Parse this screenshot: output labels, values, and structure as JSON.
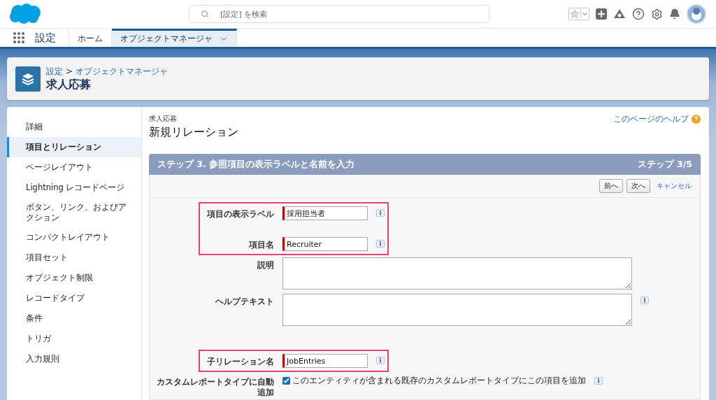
{
  "header": {
    "search": {
      "placeholder": "[設定] を検索"
    }
  },
  "nav": {
    "app_name": "設定",
    "tabs": [
      {
        "label": "ホーム",
        "selected": false,
        "dropdown": false
      },
      {
        "label": "オブジェクトマネージャ",
        "selected": true,
        "dropdown": true
      }
    ]
  },
  "page_header": {
    "breadcrumb": [
      {
        "label": "設定"
      },
      {
        "label": "オブジェクトマネージャ"
      }
    ],
    "separator": ">",
    "title": "求人応募"
  },
  "sidebar": {
    "items": [
      {
        "label": "詳細",
        "selected": false
      },
      {
        "label": "項目とリレーション",
        "selected": true
      },
      {
        "label": "ページレイアウト",
        "selected": false
      },
      {
        "label": "Lightning レコードページ",
        "selected": false
      },
      {
        "label": "ボタン、リンク、およびアクション",
        "selected": false
      },
      {
        "label": "コンパクトレイアウト",
        "selected": false
      },
      {
        "label": "項目セット",
        "selected": false
      },
      {
        "label": "オブジェクト制限",
        "selected": false
      },
      {
        "label": "レコードタイプ",
        "selected": false
      },
      {
        "label": "条件",
        "selected": false
      },
      {
        "label": "トリガ",
        "selected": false
      },
      {
        "label": "入力規則",
        "selected": false
      }
    ]
  },
  "main": {
    "object": "求人応募",
    "title": "新規リレーション",
    "help_link": "このページのヘルプ",
    "step_title": "ステップ 3. 参照項目の表示ラベルと名前を入力",
    "step_count": "ステップ 3/5",
    "buttons": [
      "前へ",
      "次へ"
    ],
    "cancel": "キャンセル",
    "fields": [
      {
        "kind": "input",
        "label": "項目の表示ラベル",
        "value": "採用担当者",
        "required": true,
        "info": true,
        "highlighted": true
      },
      {
        "kind": "input",
        "label": "項目名",
        "value": "Recruiter",
        "required": true,
        "info": true,
        "highlighted": true
      },
      {
        "kind": "textarea",
        "label": "説明",
        "info": false,
        "highlighted": false
      },
      {
        "kind": "textarea",
        "label": "ヘルプテキスト",
        "info": true,
        "highlighted": false
      },
      {
        "kind": "input",
        "label": "子リレーション名",
        "value": "JobEntries",
        "required": true,
        "info": true,
        "highlighted": true
      },
      {
        "kind": "checkbox",
        "label": "カスタムレポートタイプに自動追加",
        "text": "このエンティティが含まれる既存のカスタムレポートタイプにこの項目を追加",
        "checked": true,
        "info": true,
        "highlighted": false
      }
    ]
  }
}
